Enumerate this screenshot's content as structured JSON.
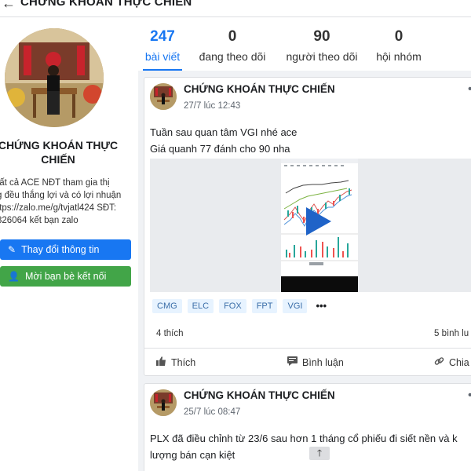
{
  "header": {
    "title": "CHỨNG KHOÁN THỰC CHIẾN",
    "back_icon": "back-arrow-icon"
  },
  "profile": {
    "name": "CHỨNG KHOÁN THỰC CHIẾN",
    "bio_lines": [
      "tất cả ACE NĐT tham gia thị",
      "g đều thắng lợi và có lợi nhuận",
      "ttps://zalo.me/g/tvjatl424   SĐT:",
      "326064 kết bạn zalo"
    ],
    "edit_button": "Thay đổi thông tin",
    "invite_button": "Mời bạn bè kết nối"
  },
  "stats": [
    {
      "value": "247",
      "label": "bài viết"
    },
    {
      "value": "0",
      "label": "đang theo dõi"
    },
    {
      "value": "90",
      "label": "người theo dõi"
    },
    {
      "value": "0",
      "label": "hội nhóm"
    }
  ],
  "posts": [
    {
      "author": "CHỨNG KHOÁN THỰC CHIẾN",
      "time": "27/7 lúc 12:43",
      "lines": [
        "Tuần sau quan tâm VGI nhé ace",
        "Giá quanh 77 đánh cho 90 nha"
      ],
      "tags": [
        "CMG",
        "ELC",
        "FOX",
        "FPT",
        "VGI"
      ],
      "tag_more": "•••",
      "likes": "4 thích",
      "comments": "5 bình lu",
      "actions": {
        "like": "Thích",
        "comment": "Bình luận",
        "share": "Chia"
      }
    },
    {
      "author": "CHỨNG KHOÁN THỰC CHIẾN",
      "time": "25/7 lúc 08:47",
      "lines": [
        "PLX đã điều chỉnh từ 23/6 sau hơn 1 tháng cổ phiếu đi siết nền và k",
        "lượng bán cạn kiệt"
      ]
    }
  ],
  "colors": {
    "accent": "#1877f2",
    "green": "#42a548",
    "tag_bg": "#e7f3ff"
  }
}
